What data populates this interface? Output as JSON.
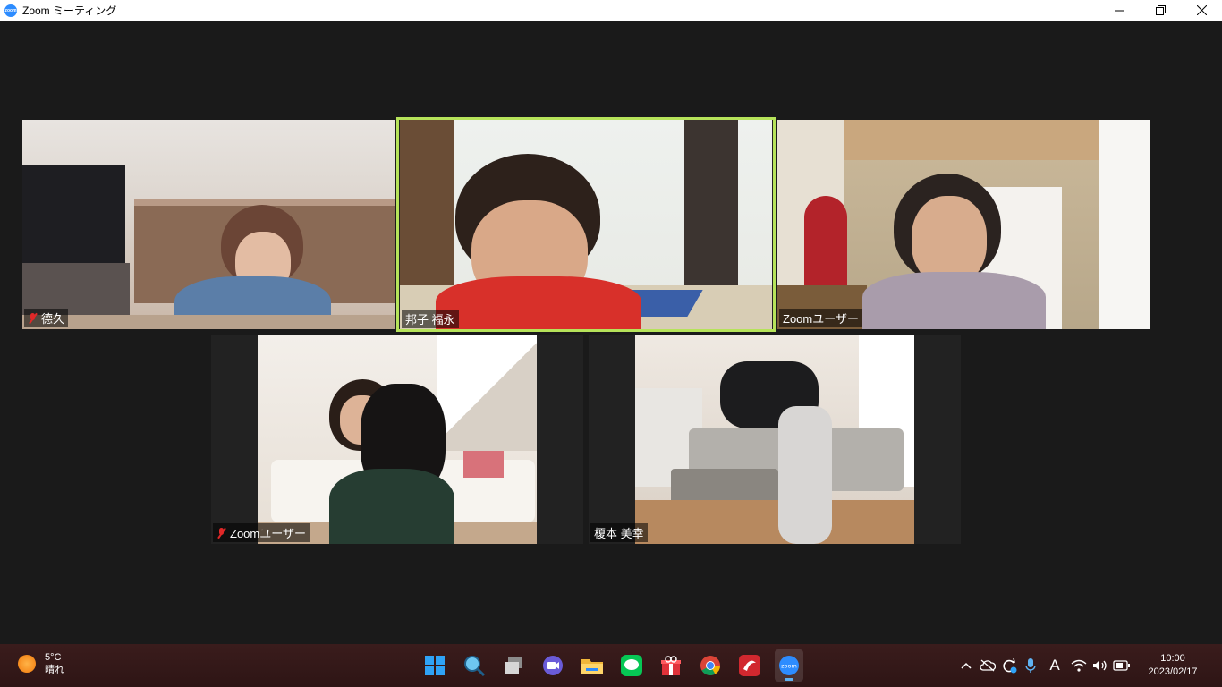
{
  "window": {
    "title": "Zoom ミーティング",
    "app_icon_text": "zoom"
  },
  "participants": [
    {
      "name": "德久",
      "muted": true
    },
    {
      "name": "邦子 福永",
      "muted": false,
      "active_speaker": true
    },
    {
      "name": "Zoomユーザー",
      "muted": false
    },
    {
      "name": "Zoomユーザー",
      "muted": true
    },
    {
      "name": "榎本 美幸",
      "muted": false
    }
  ],
  "taskbar": {
    "weather": {
      "temperature": "5°C",
      "condition": "晴れ"
    },
    "apps": [
      "windows-start-icon",
      "search-icon",
      "task-view-icon",
      "meet-icon",
      "file-explorer-icon",
      "line-icon",
      "gift-icon",
      "chrome-icon",
      "security-app-icon",
      "zoom-icon"
    ],
    "zoom_icon_text": "zoom",
    "ime_indicator": "A",
    "clock": {
      "time": "10:00",
      "date": "2023/02/17"
    }
  },
  "colors": {
    "active_border": "#b6e35a",
    "zoom_blue": "#2d8cff",
    "muted_red": "#e02828"
  }
}
